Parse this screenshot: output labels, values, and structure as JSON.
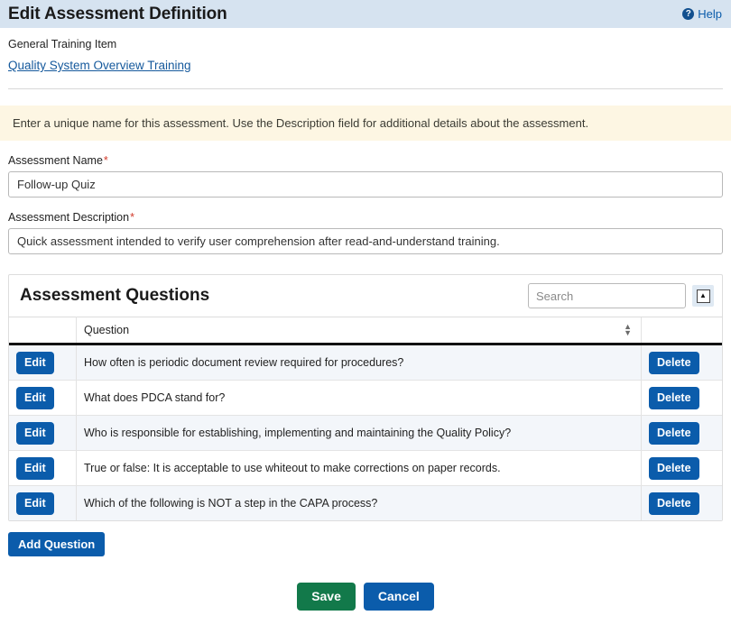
{
  "header": {
    "title": "Edit Assessment Definition",
    "help_label": "Help",
    "help_icon": "question-circle-icon"
  },
  "context": {
    "label": "General Training Item",
    "link_text": "Quality System Overview Training"
  },
  "banner": {
    "text": "Enter a unique name for this assessment. Use the Description field for additional details about the assessment."
  },
  "form": {
    "name_label": "Assessment Name",
    "name_required_marker": "*",
    "name_value": "Follow-up Quiz",
    "name_placeholder": "",
    "description_label": "Assessment Description",
    "description_required_marker": "*",
    "description_value": "Quick assessment intended to verify user comprehension after read-and-understand training.",
    "description_placeholder": ""
  },
  "questions_panel": {
    "title": "Assessment Questions",
    "search_placeholder": "Search",
    "search_value": "",
    "collapse_icon": "triangle-up-icon",
    "collapse_glyph": "▲",
    "sort_icon": "sort-chevron-icon",
    "columns": {
      "edit": "",
      "question": "Question",
      "delete": ""
    },
    "edit_label": "Edit",
    "delete_label": "Delete",
    "rows": [
      {
        "question": "How often is periodic document review required for procedures?"
      },
      {
        "question": "What does PDCA stand for?"
      },
      {
        "question": "Who is responsible for establishing, implementing and maintaining the Quality Policy?"
      },
      {
        "question": "True or false: It is acceptable to use whiteout to make corrections on paper records."
      },
      {
        "question": "Which of the following is NOT a step in the CAPA process?"
      }
    ]
  },
  "actions": {
    "add_question_label": "Add Question",
    "save_label": "Save",
    "cancel_label": "Cancel"
  },
  "colors": {
    "titlebar_bg": "#d6e3f0",
    "banner_bg": "#fdf6e3",
    "primary_blue": "#0b5cab",
    "save_green": "#12794a",
    "link_blue": "#15599c",
    "required_red": "#d23b2b",
    "row_alt_bg": "#f3f6fa"
  }
}
